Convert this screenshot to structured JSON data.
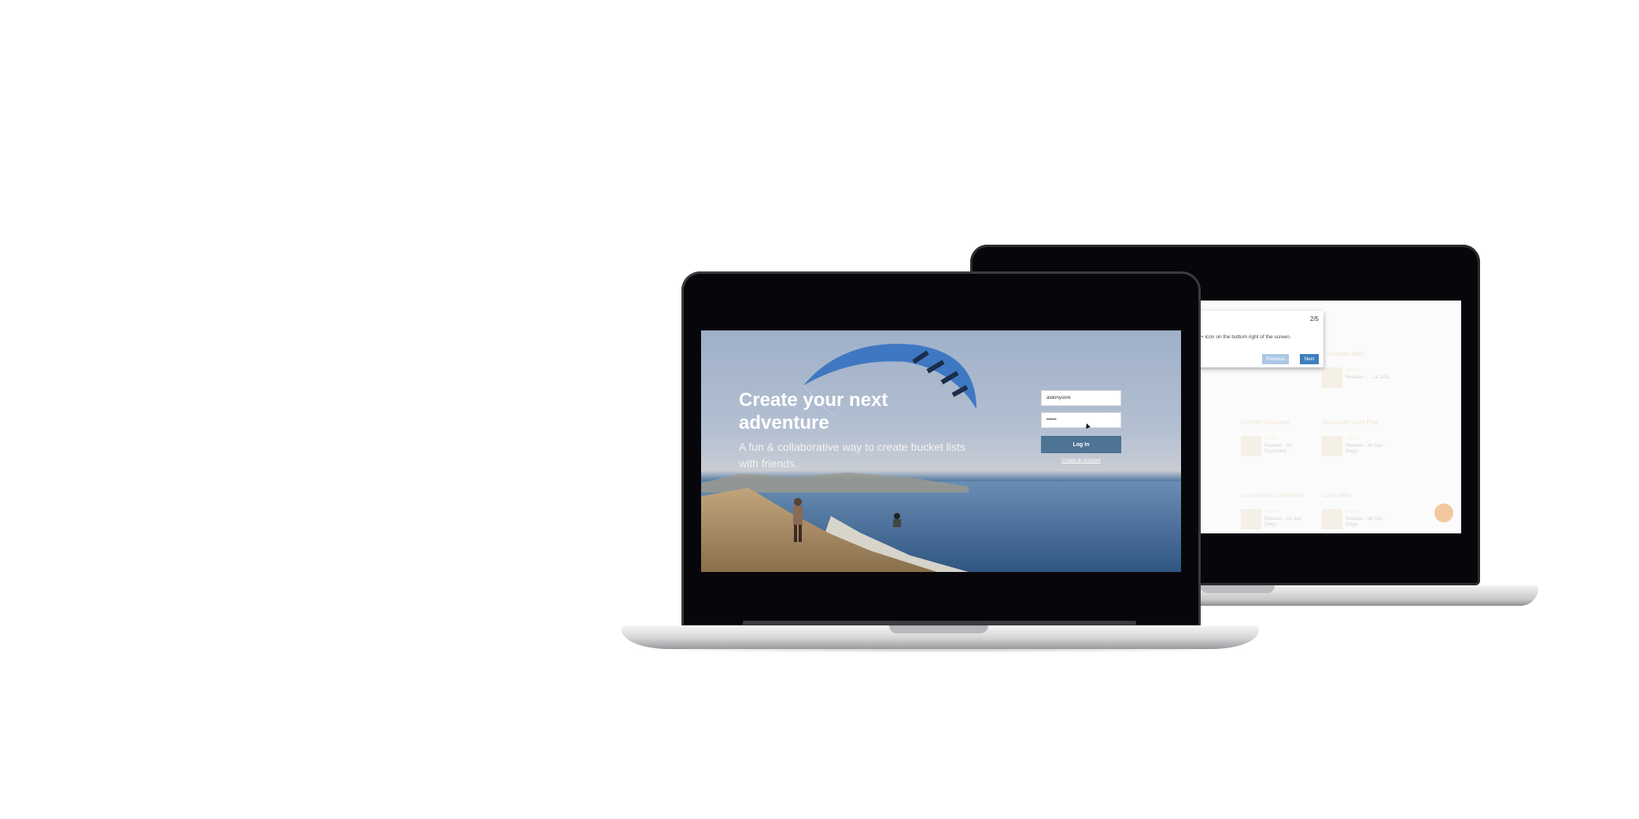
{
  "hero": {
    "title": "Create your next adventure",
    "subtitle": "A fun & collaborative way to create bucket lists with friends."
  },
  "login": {
    "username_value": "alokmysore",
    "password_value": "••••••",
    "login_button": "Log In",
    "create_account_link": "Create an Account"
  },
  "tour": {
    "step": "2/5",
    "text": "+ icon on the bottom right of the screen.",
    "previous_button": "Previous",
    "next_button": "Next"
  },
  "back_app": {
    "cards": [
      {
        "title": "...Sausages BBQ",
        "meta": "Reviews · ... La Jolla"
      },
      {
        "title": "Skyscraper Sushi Plate",
        "meta": "Reviews · 40 San Diego"
      },
      {
        "title": "Crumble Croissants",
        "meta": "Reviews · 20 Escondido"
      },
      {
        "title": "Lucky Bread Coffeehouse",
        "meta": "Reviews · 14 San Diego"
      },
      {
        "title": "Cafe Coffee",
        "meta": "Reviews · 4d San Diego"
      }
    ]
  },
  "colors": {
    "login_button": "#4d7395",
    "tour_next": "#3f7fbf",
    "tour_prev": "#a9c8e4",
    "fab": "#f3c89e",
    "laptop_bezel": "#07070b"
  },
  "icons": {
    "fab": "plus-icon",
    "cursor": "mouse-pointer-icon"
  }
}
